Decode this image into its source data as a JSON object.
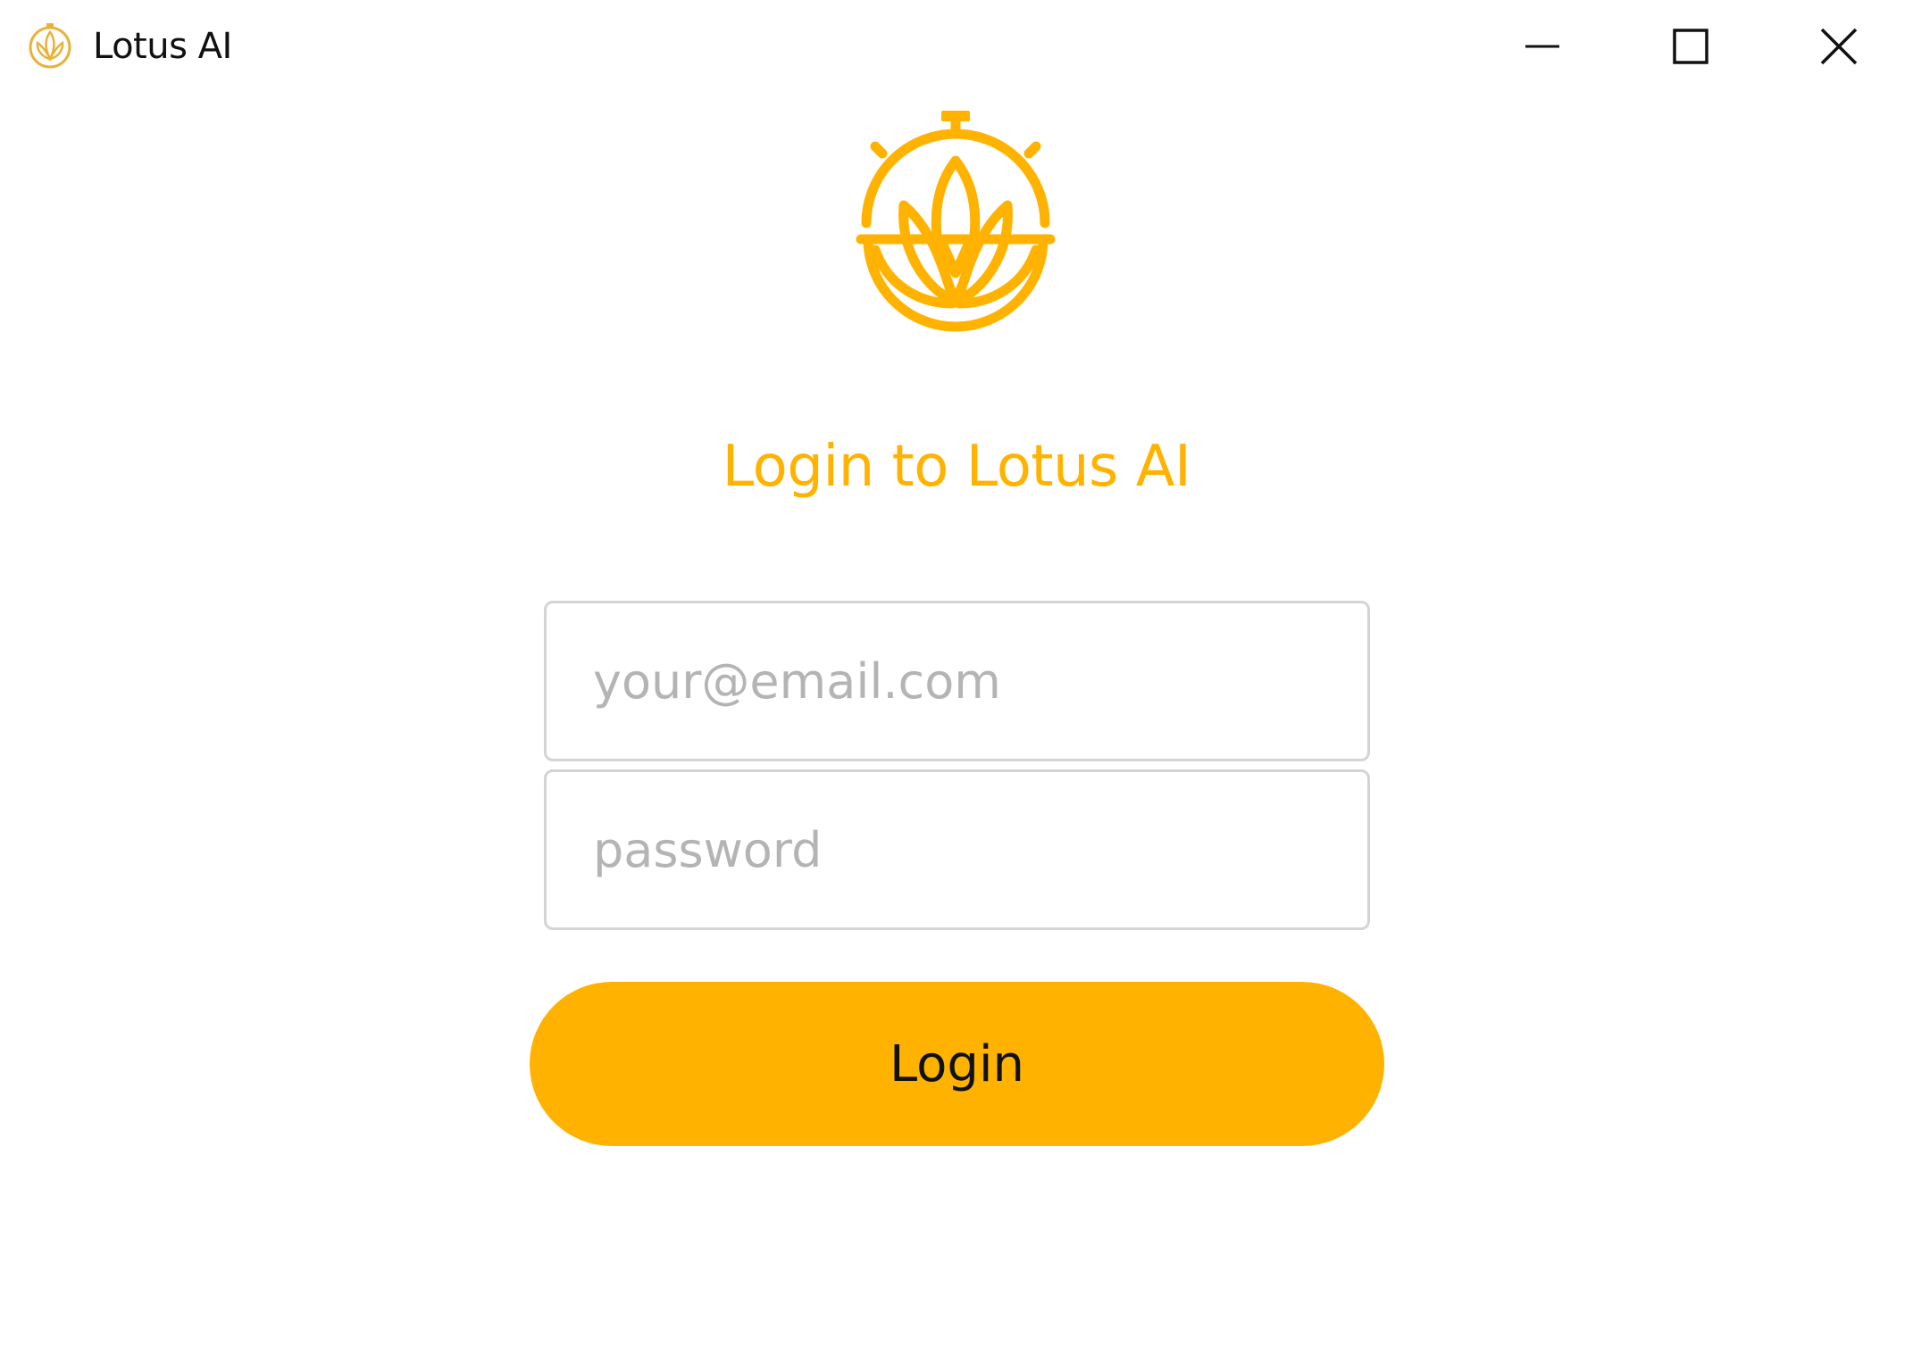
{
  "window": {
    "title": "Lotus AI",
    "controls": {
      "minimize": "minimize-icon",
      "maximize": "maximize-icon",
      "close": "close-icon"
    }
  },
  "logo": {
    "icon": "lotus-stopwatch-logo-icon",
    "color": "#FFB300"
  },
  "login": {
    "heading": "Login to Lotus AI",
    "email_placeholder": "your@email.com",
    "email_value": "",
    "password_placeholder": "password",
    "password_value": "",
    "submit_label": "Login"
  },
  "colors": {
    "accent": "#FFB300",
    "input_border": "#d4d4d4",
    "placeholder": "#b4b4b4",
    "background": "#ffffff"
  }
}
